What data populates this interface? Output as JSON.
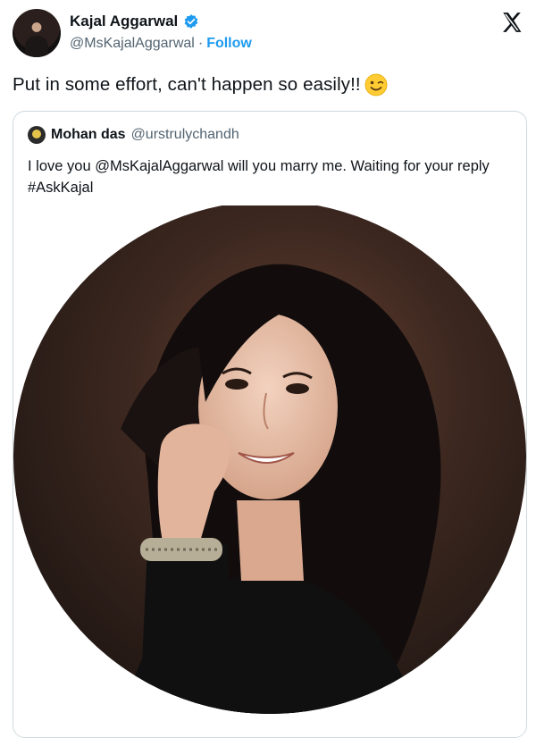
{
  "author": {
    "display_name": "Kajal Aggarwal",
    "handle": "@MsKajalAggarwal",
    "separator": "·",
    "follow_label": "Follow"
  },
  "tweet": {
    "text": "Put in some effort, can't happen so easily!!"
  },
  "quoted": {
    "display_name": "Mohan das",
    "handle": "@urstrulychandh",
    "text": "I love you @MsKajalAggarwal will you marry me. Waiting for your reply #AskKajal"
  },
  "icons": {
    "verified": "verified-badge-icon",
    "platform": "x-logo-icon",
    "emoji": "winking-face-emoji"
  },
  "colors": {
    "link": "#1d9bf0",
    "text": "#0f1419",
    "muted": "#536471",
    "border": "#cfd9de"
  }
}
